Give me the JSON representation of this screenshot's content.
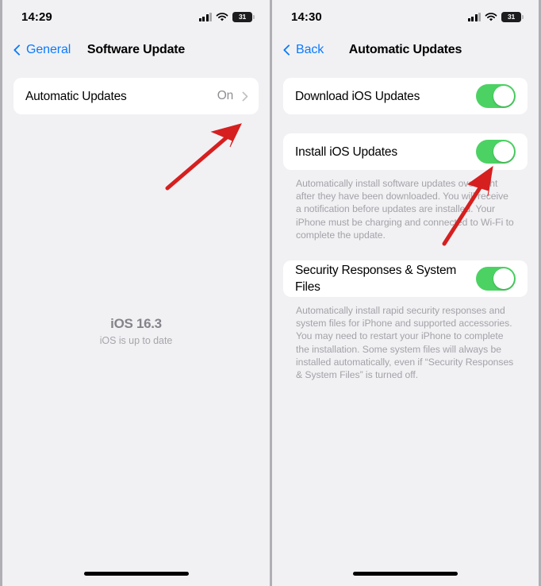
{
  "screens": [
    {
      "name": "software-update",
      "status_bar": {
        "time": "14:29",
        "signal_icon": "cellular-signal-icon",
        "wifi_icon": "wifi-icon",
        "battery_icon": "battery-icon",
        "battery_level": "31"
      },
      "nav": {
        "back_label": "General",
        "back_icon": "chevron-left-icon",
        "title": "Software Update"
      },
      "rows": [
        {
          "label": "Automatic Updates",
          "value": "On",
          "disclosure_icon": "chevron-right-icon"
        }
      ],
      "version": {
        "title": "iOS 16.3",
        "subtitle": "iOS is up to date"
      },
      "annotation": {
        "icon": "red-arrow-icon",
        "color": "#d61f1f",
        "points_to": "automatic-updates-disclosure"
      }
    },
    {
      "name": "automatic-updates",
      "status_bar": {
        "time": "14:30",
        "signal_icon": "cellular-signal-icon",
        "wifi_icon": "wifi-icon",
        "battery_icon": "battery-icon",
        "battery_level": "31"
      },
      "nav": {
        "back_label": "Back",
        "back_icon": "chevron-left-icon",
        "title": "Automatic Updates"
      },
      "sections": [
        {
          "label": "Download iOS Updates",
          "toggle_state": "on",
          "footnote": ""
        },
        {
          "label": "Install iOS Updates",
          "toggle_state": "on",
          "footnote": "Automatically install software updates overnight after they have been downloaded. You will receive a notification before updates are installed. Your iPhone must be charging and connected to Wi-Fi to complete the update."
        },
        {
          "label": "Security Responses & System Files",
          "toggle_state": "on",
          "footnote": "Automatically install rapid security responses and system files for iPhone and supported accessories. You may need to restart your iPhone to complete the installation. Some system files will always be installed automatically, even if “Security Responses & System Files” is turned off."
        }
      ],
      "annotation": {
        "icon": "red-arrow-icon",
        "color": "#d61f1f",
        "points_to": "install-ios-updates-toggle"
      }
    }
  ],
  "colors": {
    "toggle_on": "#4cd263",
    "accent_blue": "#0a7aff",
    "annotation_red": "#d61f1f",
    "background": "#f1f1f4",
    "card": "#ffffff"
  }
}
